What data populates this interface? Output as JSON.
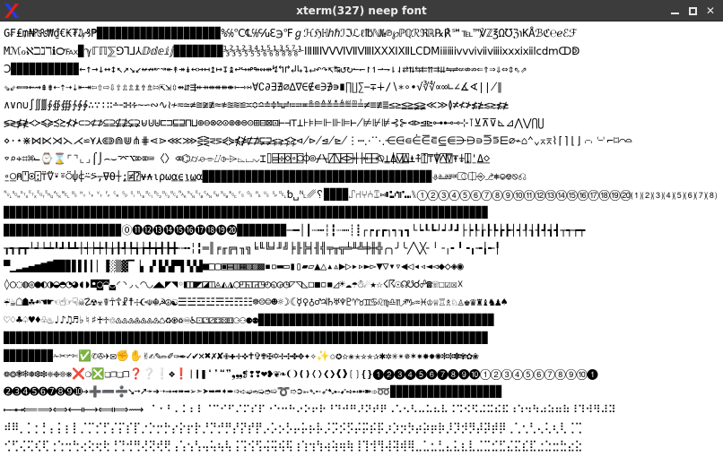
{
  "window": {
    "title": "xterm(327) neep font",
    "app_icon": "x-logo-icon",
    "controls": {
      "minimize_icon": "minimize-icon",
      "maximize_icon": "maximize-icon",
      "close_icon": "close-icon",
      "close_label": "✕"
    }
  },
  "terminal": {
    "rows": [
      "G₣₤₥₦₧₨₩₫€₭₮₯₰₱▉▉▉▉▉▉▉▉▉▉▉▉▉▉▉▉▉▉▉▉%℅℃℄℅℆ℇ℈℉ℊℋℌℍℎℏℐℑℒℓ℔ℕ№℗℘ℙℚℛℜℝ℞℟℠℡™℣ℤ℥Ω℧ℨ℩KÅℬℭ℮ℯℰℱ",
      "Mℳℴℵℶℷℸℹ℺℻▉ℽℾℿ⅀⅁⅂⅃⅄ⅅⅆⅇⅈⅉ▉▉▉▉▉▉▉▉⅓⅔⅕⅖⅗⅘⅙⅚⅛⅜⅝⅞⅟ⅠⅡⅢⅣⅤⅥⅦⅧⅨⅩⅪⅫⅬⅭⅮⅯⅰⅱⅲⅳⅴⅵⅶⅷⅸⅹⅺⅻⅼⅽⅾⅿↀↁ",
      "Ↄ▉▉▉▉▉▉▉▉▉▉▉←↑→↓↔↕↖↗↘↙↚↛↜↝↞↟↠↡↢↣↤↥↦↧↨↩↪↫↬↭↮↯↰↱↲↳↴↵↶↷↸↹↺↻↼↽↾↿⇀⇁⇂⇃⇄⇅⇆⇇⇈⇉⇊⇋⇌⇍⇎⇏⇐⇑⇒⇓⇔⇕⇖⇗",
      "⇘⇙⇚⇛⇜⇝⇞⇟⇠⇡⇢⇣⇤⇥⇦⇧⇨⇩⇪⇫⇬⇭⇮⇯⇰⇱⇲⇳⇴⇵⇶⇷⇸⇹⇺⇻⇼⇽⇾⇿∀∁∂∃∄∅∆∇∈∉∊∋∌∍∎∏∐∑−∓∔∕∖∗∘∙√∛∜∝∞∟∠∡∢∣∤∥",
      "∧∨∩∪∫∬∭∮∯∰∱∲∳∴∵∶∷∸∹∺∻∼∽∾∿≀≁≂≃≄≅≆≇≈≉≊≋≌≍≎≏≐≑≒≓≔≕≖≗≘≙≚≛≜≝≞≟≠≡≢≣≤≥≦≧≨≩≪≫≬≭≮≯≰≱≲≳≴≵",
      "≶≷≸≹≺≻≼≽≾≿⊀⊁⊂⊃⊄⊅⊆⊇⊈⊉⊊⊋⊌⊍⊎⊏⊐⊑⊒⊓⊔⊕⊖⊗⊘⊙⊚⊛⊜⊝⊞⊟⊠⊡⊢⊣⊤⊥⊦⊧⊨⊩⊪⊫⊬⊭⊮⊯⊰⊱⊲⊳⊴⊵⊶⊷⊸⊹⊺⊻⊼⊽⊾⊿⋀⋁⋂⋃",
      "⋄⋅⋆⋇⋈⋉⋊⋋⋌⋍⋎⋏⋐⋑⋒⋓⋔⋕⋖⋗⋘⋙⋚⋛⋜⋝⋞⋟⋠⋡⋢⋣⋤⋥⋦⋧⋨⋩⋪⋫⋬⋭⋮⋯⋰⋱⋲⋳⋴⋵⋶⋷⋸⋹⋺⋻⋼⋽⋾⋿⌀⌁⌂⌃⌄⌅⌆⌇⌈⌉⌊⌋⌌⌍⌎⌏⌐⌑⌒⌓",
      "⌔⌕⌖⌗⌘⌙⌚⌛⌜⌝⌞⌟⌠⌡⌢⌣⌤⌥⌦⌧⌨〈〉⌫⌬⌭⌮⌯⌰⌱⌲⌳⌴⌵⌶⌷⌸⌹⌺⌻⌼⌽⌾⌿⍀⍁⍂⍃⍄⍅⍆⍇⍈⍉⍊⍋⍌⍍⍎⍏⍐⍑⍒⍓⍔⍕⍖⍗⍘⍙⍚",
      "⍛⍜⍝⍞⍟⍠⍡⍢⍣⍤⍥⍦⍧⍨⍩⍪⍫⍬⍭⍮⍯⍰⍱⍲⍳⍴⍵⍶⍷⍸⍹⍺▉▉▉▉▉▉▉▉▉▉▉▉▉▉▉▉▉▉▉▉▉▉▉▉▉▉▉▉▉▉▉▉▉▉▉▉▉⎀⎁⎂⎃⎄⎅⎆⎇⎈⎉⎊⎋⎌",
      "␀␁␂␃␄␅␆␇␈␉␊␋␌␍␎␏␐␑␒␓␔␕␖␗␘␙␚␛␜␝␞␟␠␡␢␣␤␥␦▉▉▉▉⑀⑁⑂⑃⑄⑅⑆⑇⑈⑉⑊①②③④⑤⑥⑦⑧⑨⑩⑪⑫⑬⑭⑮⑯⑰⑱⑲⑳⑴⑵⑶⑷⑸⑹⑺⑻",
      "▉▉▉▉▉▉▉▉▉▉▉▉▉▉▉▉▉▉▉▉▉▉▉▉▉▉▉▉▉▉▉▉▉▉▉▉▉▉▉▉▉▉▉▉▉▉▉▉▉▉▉▉▉▉▉▉▉▉▉▉▉▉▉▉▉▉▉▉▉▉▉▉▉▉▉▉▉▉",
      "▉▉▉▉▉▉▉▉▉▉▉▉▉▉▉▉▉▉▉⓪⓫⓬⓭⓮⓯⓰⓱⓲⓳⓴▉▉▉▉▉▉▉▉─━│┃┄┅┆┇┈┉┊┋┌┍┎┏┐┑┒┓└┕┖┗┘┙┚┛├┝┞┟┠┡┢┣┤┥┦┧┨┩┪┫┬┭┮┯",
      "┰┱┲┳┴┵┶┷┸┹┺┻┼┽┾┿╀╁╂╃╄╅╆╇╈╉╊╋╌╍╎╏═║╒╓╔╕╖╗╘╙╚╛╜╝╞╟╠╡╢╣╤╥╦╧╨╩╪╫╬╭╮╯╰╱╲╳╴╵╶╷╸╹╺╻╼╽╾╿",
      "▀▁▂▃▄▅▆▇█▉▊▋▌▍▎▏▐░▒▓▔▕▖▗▘▙▚▛▜▝▞▟■□▢▣▤▥▦▧▨▩▪▫▬▭▮▯▰▱▲△▴▵▶▷▸▹►▻▼▽▾▿◀◁◂◃◄◅◆◇◈◉",
      "◊○◌◍◎●◐◑◒◓◔◕◖◗◘◙◚◛◜◝◞◟◠◡◢◣◤◥◦◧◨◩◪◫◬◭◮◯◰◱◲◳◴◵◶◷◸◹◺◻◼◽◾◿☀☁☂☃☄★☆☇☈☉☊☋☌☍☎☏☐☑☒☓",
      "☔☕☖☗☘☙☚☛☜☝☞☟☠☡☢☣☤☥☦☧☨☩☪☫☬☭☮☯☰☱☲☳☴☵☶☷☸☹☺☻☼☽☾☿♀♁♂♃♄♅♆♇♈♉♊♋♌♍♎♏♐♑♒♓♔♕♖♗♘♙♚♛♜♝♞♟♠",
      "♡♢♣♤♥♦♧♨♩♪♫♬♭♮♯♰♱♲♳♴♵♶♷♸♹♺♻♼♽♾♿⚀⚁⚂⚃⚄⚅⚆⚇⚈⚉▉▉▉▉▉▉▉▉▉▉▉▉▉▉▉▉▉▉▉▉▉▉▉▉▉▉▉▉▉▉▉▉▉▉▉▉▉▉",
      "▉▉▉▉▉▉▉▉▉▉▉▉▉▉▉▉▉▉▉▉▉▉▉▉▉▉▉▉▉▉▉▉▉▉▉▉▉▉▉▉▉▉▉▉▉▉▉▉▉▉▉▉▉▉▉▉▉▉▉▉▉▉▉▉▉▉▉▉▉▉▉▉▉▉▉▉▉▉",
      "▉▉▉▉▉▉▉▉✁✂✃✄✅✆✇✈✉✊✋✌✍✎✏✐✑✒✓✔✕✖✗✘✙✚✛✜✝✞✟✠✡✢✣✤✥✦✧✨✩✪✫✬✭✮✯✰✱✲✳✴✵✶✷✸✹✺✻✼✽✾✿❀",
      "❁❂❃❄❅❆❇❈❉❊❋❌❍❎❏❐❑❒❓❔❕❖❗❘❙❚❛❜❝❞❟❠❡❢❣❤❥❦❧❨❩❪❫❬❭❮❯❰❱❲❳❴❵❶❷❸❹❺❻❼❽❾❿➀➁➂➃➄➅➆➇➈➉➊",
      "➋➌➍➎➏➐➑➒➓➔➕➖➗➘➙➚➛➜➝➞➟➠➡➢➣➤➥➦➧➨➩➪➫➬➭➮➯➰➱➲➳➴➵➶➷➸➹➺➻➼➽➾➿▉▉▉▉▉▉▉▉▉▉▉▉▉▉▉▉▉▉",
      "⟵⟶⟷⟸⟹⟺⟻⟼⟽⟾⟿⠀⠁⠂⠃⠄⠅⠆⠇⠈⠉⠊⠋⠌⠍⠎⠏⠐⠑⠒⠓⠔⠕⠖⠗⠘⠙⠚⠛⠜⠝⠞⠟⠠⠡⠢⠣⠤⠥⠦⠧⠨⠩⠪⠫⠬⠭⠮⠯⠰⠱⠲⠳⠴⠵⠶⠷⠸⠹⠺⠻⠼⠽",
      "⠾⠿⡀⡁⡂⡃⡄⡅⡆⡇⡈⡉⡊⡋⡌⡍⡎⡏⡐⡑⡒⡓⡔⡕⡖⡗⡘⡙⡚⡛⡜⡝⡞⡟⡠⡡⡢⡣⡤⡥⡦⡧⡨⡩⡪⡫⡬⡭⡮⡯⡰⡱⡲⡳⡴⡵⡶⡷⡸⡹⡺⡻⡼⡽⡾⡿⢀⢁⢂⢃⢄⢅⢆⢇⢈⢉",
      "⢊⢋⢌⢍⢎⢏⢐⢑⢒⢓⢔⢕⢖⢗⢘⢙⢚⢛⢜⢝⢞⢟⢠⢡⢢⢣⢤⢥⢦⢧⢨⢩⢪⢫⢬⢭⢮⢯⢰⢱⢲⢳⢴⢵⢶⢷⢸⢹⢺⢻⢼⢽⢾⢿⣀⣁⣂⣃⣄⣅⣆⣇⣈⣉⣊⣋⣌⣍⣎⣏⣐⣑⣒⣓⣔⣕"
    ]
  }
}
